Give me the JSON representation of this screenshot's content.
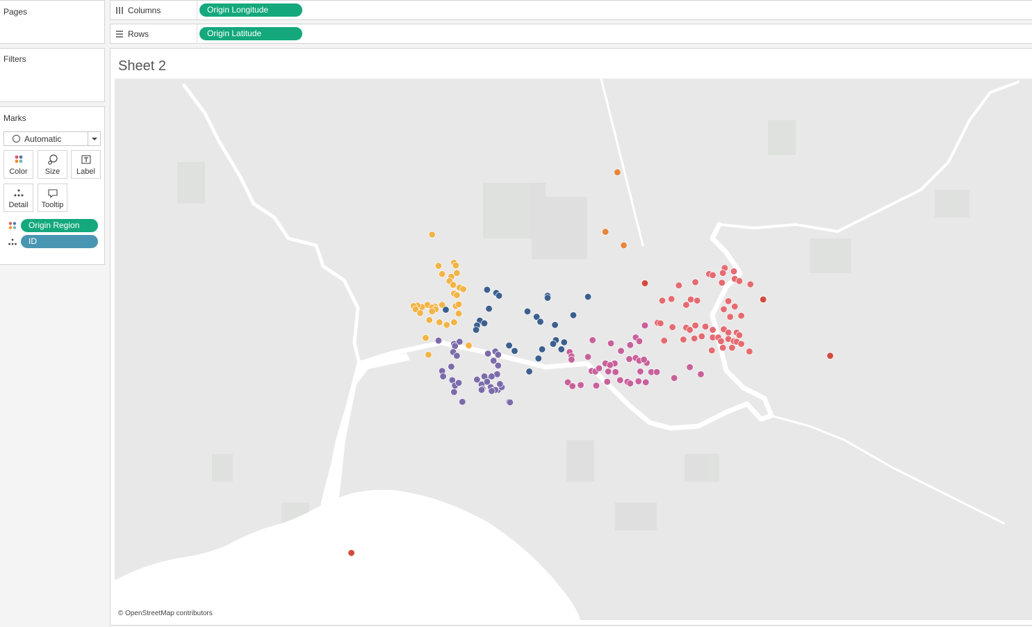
{
  "left_panel": {
    "pages_title": "Pages",
    "filters_title": "Filters",
    "marks_title": "Marks",
    "mark_type": "Automatic",
    "buttons": [
      "Color",
      "Size",
      "Label",
      "Detail",
      "Tooltip"
    ],
    "mark_fields": [
      {
        "label": "Origin Region",
        "encoding": "color",
        "color": "#14a87c"
      },
      {
        "label": "ID",
        "encoding": "detail",
        "color": "#4996b2"
      }
    ]
  },
  "shelves": {
    "columns_label": "Columns",
    "columns_field": "Origin Longitude",
    "rows_label": "Rows",
    "rows_field": "Origin Latitude"
  },
  "sheet": {
    "title": "Sheet 2",
    "credit": "© OpenStreetMap contributors"
  },
  "colors": {
    "pill": "#14a87c",
    "pill_detail": "#4996b2",
    "map_land": "#e8e8e8",
    "map_water": "#ffffff"
  },
  "chart_data": {
    "type": "scatter",
    "xlabel": "Origin Longitude",
    "ylabel": "Origin Latitude",
    "series": [
      {
        "color": "#f2b447",
        "points": [
          [
            0.346,
            0.288
          ],
          [
            0.353,
            0.346
          ],
          [
            0.37,
            0.34
          ],
          [
            0.372,
            0.345
          ],
          [
            0.357,
            0.361
          ],
          [
            0.367,
            0.366
          ],
          [
            0.373,
            0.359
          ],
          [
            0.365,
            0.374
          ],
          [
            0.369,
            0.381
          ],
          [
            0.376,
            0.386
          ],
          [
            0.37,
            0.397
          ],
          [
            0.373,
            0.4
          ],
          [
            0.38,
            0.389
          ],
          [
            0.349,
            0.421
          ],
          [
            0.341,
            0.418
          ],
          [
            0.335,
            0.422
          ],
          [
            0.33,
            0.419
          ],
          [
            0.326,
            0.42
          ],
          [
            0.328,
            0.426
          ],
          [
            0.346,
            0.423
          ],
          [
            0.35,
            0.426
          ],
          [
            0.357,
            0.418
          ],
          [
            0.372,
            0.42
          ],
          [
            0.375,
            0.417
          ],
          [
            0.346,
            0.43
          ],
          [
            0.333,
            0.433
          ],
          [
            0.343,
            0.446
          ],
          [
            0.354,
            0.45
          ],
          [
            0.37,
            0.45
          ],
          [
            0.375,
            0.434
          ],
          [
            0.362,
            0.455
          ],
          [
            0.339,
            0.479
          ],
          [
            0.386,
            0.493
          ],
          [
            0.342,
            0.51
          ]
        ]
      },
      {
        "color": "#3b5f8e",
        "points": [
          [
            0.406,
            0.39
          ],
          [
            0.416,
            0.396
          ],
          [
            0.419,
            0.401
          ],
          [
            0.472,
            0.401
          ],
          [
            0.472,
            0.405
          ],
          [
            0.516,
            0.403
          ],
          [
            0.361,
            0.427
          ],
          [
            0.408,
            0.425
          ],
          [
            0.45,
            0.43
          ],
          [
            0.46,
            0.44
          ],
          [
            0.398,
            0.447
          ],
          [
            0.395,
            0.456
          ],
          [
            0.403,
            0.452
          ],
          [
            0.48,
            0.455
          ],
          [
            0.464,
            0.449
          ],
          [
            0.5,
            0.437
          ],
          [
            0.394,
            0.464
          ],
          [
            0.481,
            0.483
          ],
          [
            0.49,
            0.487
          ],
          [
            0.478,
            0.49
          ],
          [
            0.43,
            0.493
          ],
          [
            0.436,
            0.503
          ],
          [
            0.466,
            0.5
          ],
          [
            0.487,
            0.5
          ],
          [
            0.462,
            0.517
          ],
          [
            0.452,
            0.541
          ],
          [
            0.406,
            0.556
          ]
        ]
      },
      {
        "color": "#7c6bab",
        "points": [
          [
            0.353,
            0.484
          ],
          [
            0.37,
            0.49
          ],
          [
            0.376,
            0.486
          ],
          [
            0.371,
            0.494
          ],
          [
            0.369,
            0.505
          ],
          [
            0.373,
            0.512
          ],
          [
            0.407,
            0.508
          ],
          [
            0.415,
            0.504
          ],
          [
            0.418,
            0.51
          ],
          [
            0.413,
            0.521
          ],
          [
            0.418,
            0.53
          ],
          [
            0.417,
            0.546
          ],
          [
            0.411,
            0.55
          ],
          [
            0.403,
            0.55
          ],
          [
            0.395,
            0.556
          ],
          [
            0.367,
            0.532
          ],
          [
            0.357,
            0.54
          ],
          [
            0.358,
            0.55
          ],
          [
            0.368,
            0.557
          ],
          [
            0.371,
            0.567
          ],
          [
            0.375,
            0.562
          ],
          [
            0.37,
            0.579
          ],
          [
            0.4,
            0.565
          ],
          [
            0.41,
            0.57
          ],
          [
            0.413,
            0.576
          ],
          [
            0.418,
            0.575
          ],
          [
            0.43,
            0.597
          ],
          [
            0.431,
            0.598
          ],
          [
            0.379,
            0.597
          ],
          [
            0.401,
            0.573
          ],
          [
            0.422,
            0.57
          ],
          [
            0.4,
            0.575
          ],
          [
            0.42,
            0.564
          ],
          [
            0.406,
            0.56
          ],
          [
            0.415,
            0.575
          ],
          [
            0.411,
            0.577
          ]
        ]
      },
      {
        "color": "#c8609a",
        "points": [
          [
            0.521,
            0.483
          ],
          [
            0.578,
            0.456
          ],
          [
            0.568,
            0.478
          ],
          [
            0.541,
            0.489
          ],
          [
            0.562,
            0.492
          ],
          [
            0.572,
            0.485
          ],
          [
            0.552,
            0.503
          ],
          [
            0.496,
            0.505
          ],
          [
            0.498,
            0.513
          ],
          [
            0.498,
            0.519
          ],
          [
            0.516,
            0.514
          ],
          [
            0.561,
            0.518
          ],
          [
            0.568,
            0.516
          ],
          [
            0.572,
            0.521
          ],
          [
            0.58,
            0.525
          ],
          [
            0.545,
            0.526
          ],
          [
            0.535,
            0.526
          ],
          [
            0.577,
            0.519
          ],
          [
            0.54,
            0.529
          ],
          [
            0.52,
            0.54
          ],
          [
            0.524,
            0.541
          ],
          [
            0.528,
            0.535
          ],
          [
            0.538,
            0.541
          ],
          [
            0.546,
            0.542
          ],
          [
            0.573,
            0.541
          ],
          [
            0.585,
            0.542
          ],
          [
            0.591,
            0.542
          ],
          [
            0.508,
            0.566
          ],
          [
            0.494,
            0.561
          ],
          [
            0.499,
            0.568
          ],
          [
            0.525,
            0.567
          ],
          [
            0.537,
            0.56
          ],
          [
            0.551,
            0.557
          ],
          [
            0.559,
            0.56
          ],
          [
            0.562,
            0.563
          ],
          [
            0.571,
            0.559
          ],
          [
            0.579,
            0.561
          ],
          [
            0.627,
            0.533
          ],
          [
            0.639,
            0.546
          ],
          [
            0.61,
            0.553
          ]
        ]
      },
      {
        "color": "#e56b71",
        "points": [
          [
            0.615,
            0.382
          ],
          [
            0.633,
            0.376
          ],
          [
            0.648,
            0.361
          ],
          [
            0.652,
            0.363
          ],
          [
            0.665,
            0.35
          ],
          [
            0.675,
            0.356
          ],
          [
            0.663,
            0.359
          ],
          [
            0.662,
            0.377
          ],
          [
            0.676,
            0.37
          ],
          [
            0.681,
            0.374
          ],
          [
            0.693,
            0.38
          ],
          [
            0.597,
            0.41
          ],
          [
            0.607,
            0.407
          ],
          [
            0.628,
            0.408
          ],
          [
            0.635,
            0.41
          ],
          [
            0.623,
            0.418
          ],
          [
            0.669,
            0.411
          ],
          [
            0.676,
            0.421
          ],
          [
            0.664,
            0.426
          ],
          [
            0.671,
            0.44
          ],
          [
            0.683,
            0.438
          ],
          [
            0.592,
            0.451
          ],
          [
            0.595,
            0.452
          ],
          [
            0.608,
            0.459
          ],
          [
            0.623,
            0.46
          ],
          [
            0.633,
            0.456
          ],
          [
            0.627,
            0.464
          ],
          [
            0.644,
            0.458
          ],
          [
            0.652,
            0.464
          ],
          [
            0.664,
            0.463
          ],
          [
            0.669,
            0.469
          ],
          [
            0.678,
            0.469
          ],
          [
            0.681,
            0.474
          ],
          [
            0.64,
            0.476
          ],
          [
            0.632,
            0.48
          ],
          [
            0.62,
            0.482
          ],
          [
            0.599,
            0.484
          ],
          [
            0.652,
            0.478
          ],
          [
            0.658,
            0.478
          ],
          [
            0.661,
            0.485
          ],
          [
            0.669,
            0.481
          ],
          [
            0.675,
            0.485
          ],
          [
            0.678,
            0.486
          ],
          [
            0.651,
            0.502
          ],
          [
            0.663,
            0.497
          ],
          [
            0.673,
            0.497
          ],
          [
            0.683,
            0.49
          ],
          [
            0.692,
            0.504
          ]
        ]
      },
      {
        "color": "#d34b3f",
        "points": [
          [
            0.578,
            0.378
          ],
          [
            0.707,
            0.408
          ],
          [
            0.78,
            0.512
          ],
          [
            0.258,
            0.876
          ]
        ]
      },
      {
        "color": "#e5863d",
        "points": [
          [
            0.548,
            0.173
          ],
          [
            0.535,
            0.283
          ],
          [
            0.555,
            0.308
          ]
        ]
      }
    ]
  }
}
